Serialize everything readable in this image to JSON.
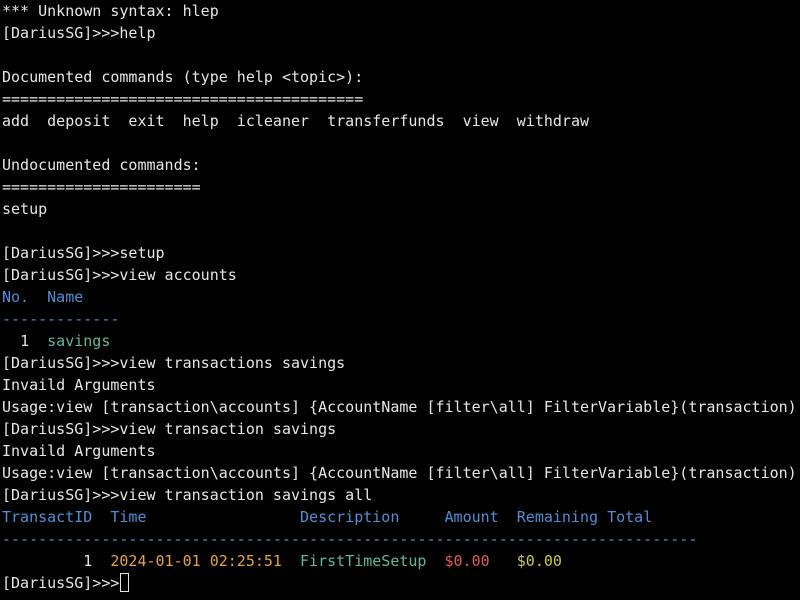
{
  "terminal": {
    "prompt": "[DariusSG]>>>",
    "lines": [
      {
        "text": "*** Unknown syntax: hlep"
      },
      {
        "cmd": "help"
      },
      {
        "text": ""
      },
      {
        "text": "Documented commands (type help <topic>):"
      },
      {
        "text": "========================================"
      },
      {
        "text": "add  deposit  exit  help  icleaner  transferfunds  view  withdraw"
      },
      {
        "text": ""
      },
      {
        "text": "Undocumented commands:"
      },
      {
        "text": "======================"
      },
      {
        "text": "setup"
      },
      {
        "text": ""
      },
      {
        "cmd": "setup"
      },
      {
        "cmd": "view accounts"
      }
    ],
    "accounts_table": {
      "col_no": "No.",
      "col_name": "Name",
      "separator": "-------------",
      "rows": [
        {
          "no": "1",
          "name": "savings"
        }
      ]
    },
    "lines_after_accounts": [
      {
        "cmd": "view transactions savings"
      },
      {
        "text": "Invaild Arguments"
      },
      {
        "text": "Usage:view [transaction\\accounts] {AccountName [filter\\all] FilterVariable}(transaction)"
      },
      {
        "cmd": "view transaction savings"
      },
      {
        "text": "Invaild Arguments"
      },
      {
        "text": "Usage:view [transaction\\accounts] {AccountName [filter\\all] FilterVariable}(transaction)"
      },
      {
        "cmd": "view transaction savings all"
      }
    ],
    "transactions_table": {
      "col_id": "TransactID",
      "col_time": "Time",
      "col_desc": "Description",
      "col_amount": "Amount",
      "col_remaining": "Remaining Total",
      "separator": "-----------------------------------------------------------------------------",
      "rows": [
        {
          "id": "1",
          "time": "2024-01-01 02:25:51",
          "desc": "FirstTimeSetup",
          "amount": "$0.00",
          "remaining": "$0.00"
        }
      ]
    },
    "colors": {
      "header": "#4f8fd6",
      "name": "#5fb8a0",
      "time": "#e8a33d",
      "amount": "#e05a55",
      "remaining": "#c9c94a"
    }
  }
}
